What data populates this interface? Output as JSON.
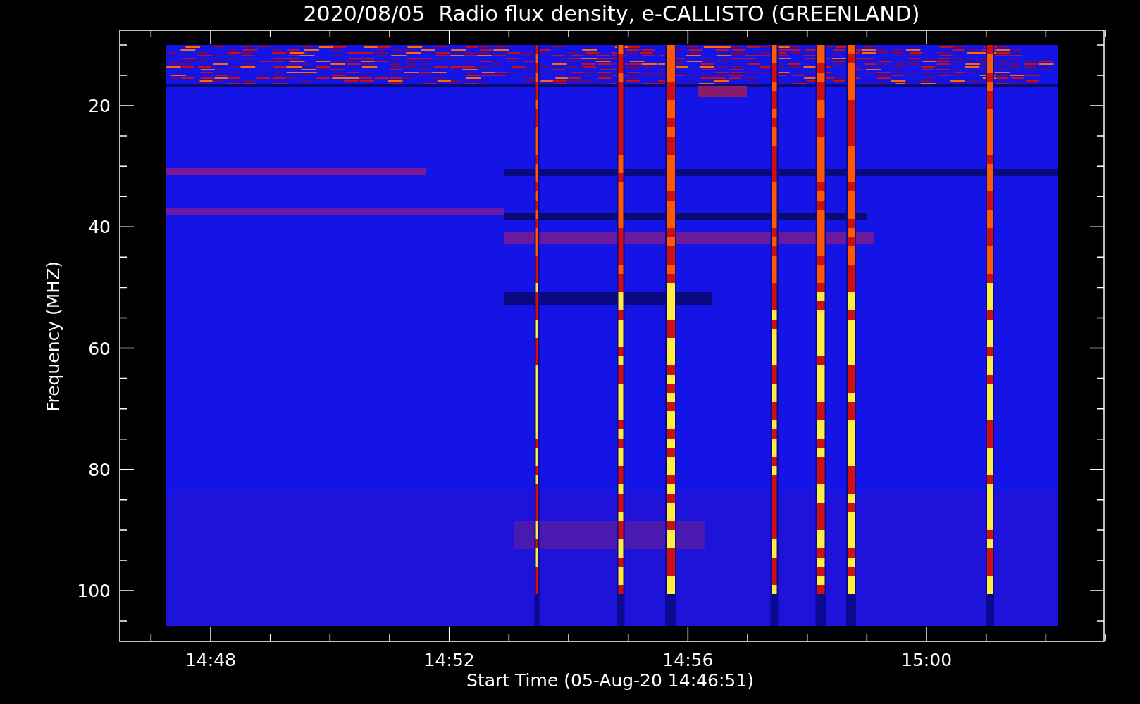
{
  "title": "2020/08/05  Radio flux density, e-CALLISTO (GREENLAND)",
  "plot": {
    "ylabel": "Frequency (MHZ)",
    "xlabel": "Start Time (05-Aug-20 14:46:51)",
    "y_tick_labels": [
      "20",
      "40",
      "60",
      "80",
      "100"
    ],
    "x_tick_labels": [
      "14:48",
      "14:52",
      "14:56",
      "15:00"
    ]
  }
}
